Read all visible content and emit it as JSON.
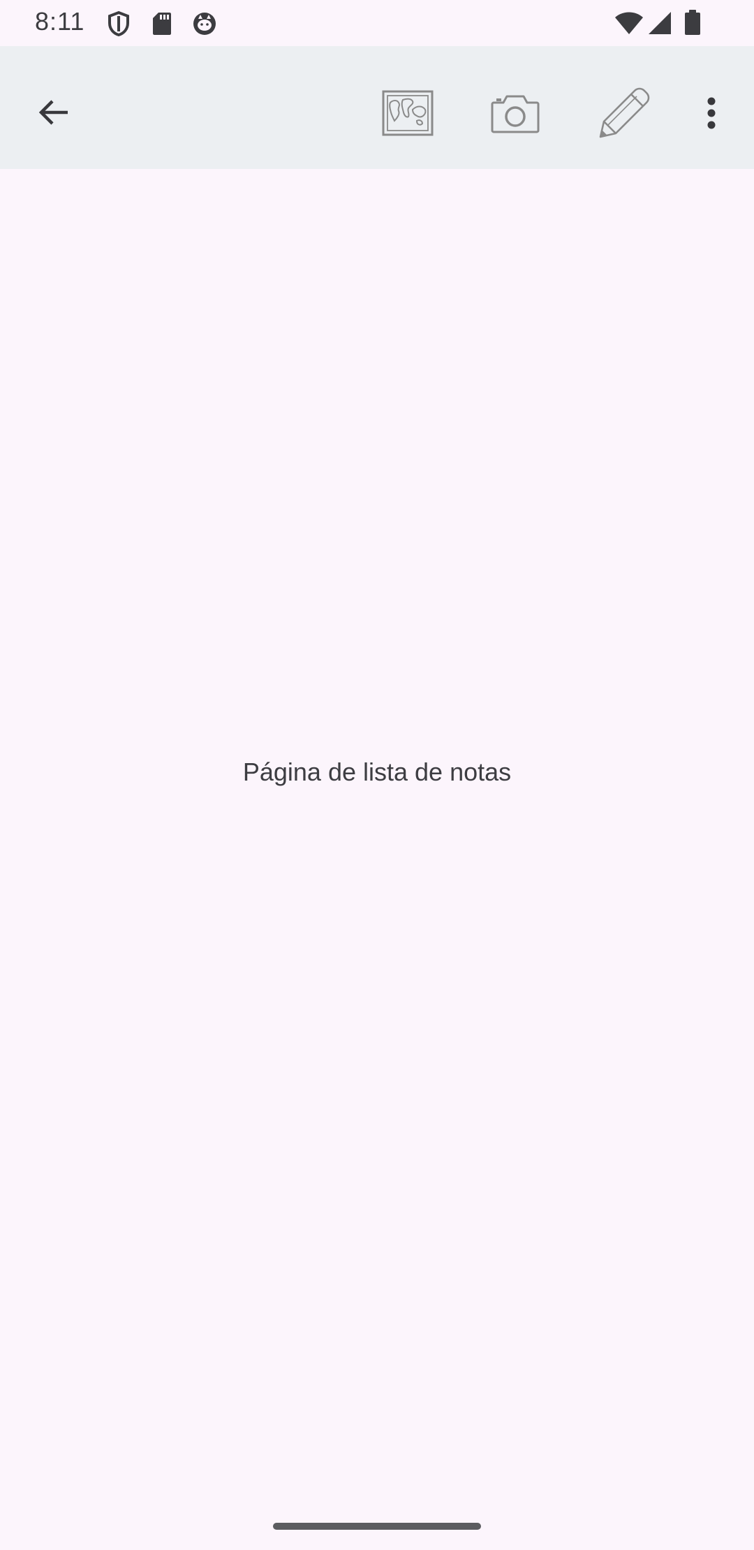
{
  "status_bar": {
    "time": "8:11",
    "icons": [
      "shield-icon",
      "sd-card-icon",
      "cat-face-icon",
      "wifi-icon",
      "cell-signal-icon",
      "battery-icon"
    ]
  },
  "toolbar": {
    "back_icon": "arrow-back-icon",
    "actions": [
      "map-icon",
      "camera-icon",
      "pencil-icon",
      "more-vert-icon"
    ]
  },
  "main": {
    "empty_message": "Página de lista de notas"
  },
  "colors": {
    "background": "#fcf5fc",
    "toolbar": "#eceff2",
    "text": "#3d3d42",
    "icon_gray": "#8a8a8a"
  }
}
